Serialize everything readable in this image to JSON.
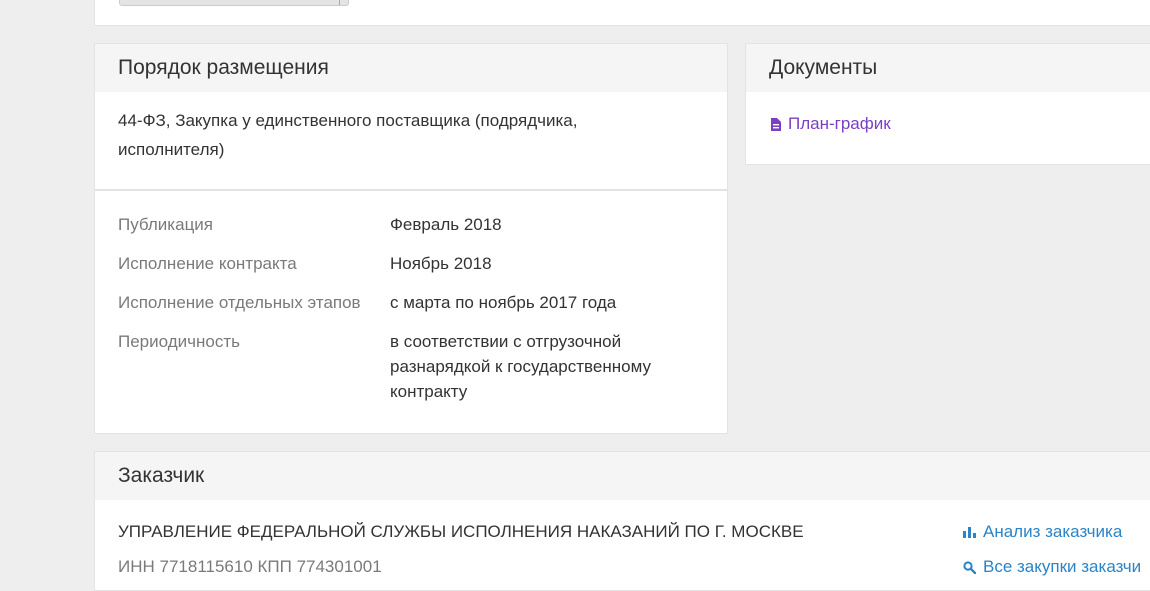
{
  "order": {
    "title": "Порядок размещения",
    "procedure_line1": "44-ФЗ, Закупка у единственного поставщика (подрядчика,",
    "procedure_line2": "исполнителя)",
    "rows": [
      {
        "label": "Публикация",
        "value": "Февраль 2018"
      },
      {
        "label": "Исполнение контракта",
        "value": "Ноябрь 2018"
      },
      {
        "label": "Исполнение отдельных этапов",
        "value": "с марта по ноябрь 2017 года"
      },
      {
        "label": "Периодичность",
        "value_line1": "в соответствии с отгрузочной",
        "value_line2": "разнарядкой к государственному",
        "value_line3": "контракту"
      }
    ]
  },
  "documents": {
    "title": "Документы",
    "link_label": "План-график",
    "link_icon": "document-icon",
    "link_color": "#7b3fc4"
  },
  "customer": {
    "title": "Заказчик",
    "name": "УПРАВЛЕНИЕ ФЕДЕРАЛЬНОЙ СЛУЖБЫ ИСПОЛНЕНИЯ НАКАЗАНИЙ ПО Г. МОСКВЕ",
    "ids": "ИНН 7718115610 КПП 774301001",
    "analyze_link": "Анализ заказчика",
    "analyze_icon": "bar-chart-icon",
    "all_purchases_link": "Все закупки заказчи",
    "all_purchases_icon": "search-icon",
    "link_color": "#2a84c7"
  }
}
